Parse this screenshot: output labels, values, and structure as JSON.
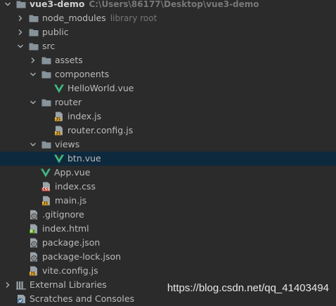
{
  "project": {
    "name": "vue3-demo",
    "path": "C:\\Users\\86177\\Desktop\\vue3-demo"
  },
  "items": [
    {
      "depth": 0,
      "arrow": "expanded",
      "icon": "folder",
      "label": "vue3-demo",
      "hint": "C:\\Users\\86177\\Desktop\\vue3-demo",
      "bold": true,
      "root": true
    },
    {
      "depth": 1,
      "arrow": "collapsed",
      "icon": "folder",
      "label": "node_modules",
      "hint": "library root"
    },
    {
      "depth": 1,
      "arrow": "collapsed",
      "icon": "folder",
      "label": "public",
      "hint": ""
    },
    {
      "depth": 1,
      "arrow": "expanded",
      "icon": "folder",
      "label": "src",
      "hint": ""
    },
    {
      "depth": 2,
      "arrow": "collapsed",
      "icon": "folder",
      "label": "assets",
      "hint": ""
    },
    {
      "depth": 2,
      "arrow": "expanded",
      "icon": "folder",
      "label": "components",
      "hint": ""
    },
    {
      "depth": 3,
      "arrow": "none",
      "icon": "vue",
      "label": "HelloWorld.vue",
      "hint": ""
    },
    {
      "depth": 2,
      "arrow": "expanded",
      "icon": "folder",
      "label": "router",
      "hint": ""
    },
    {
      "depth": 3,
      "arrow": "none",
      "icon": "js",
      "label": "index.js",
      "hint": ""
    },
    {
      "depth": 3,
      "arrow": "none",
      "icon": "js",
      "label": "router.config.js",
      "hint": ""
    },
    {
      "depth": 2,
      "arrow": "expanded",
      "icon": "folder",
      "label": "views",
      "hint": ""
    },
    {
      "depth": 3,
      "arrow": "none",
      "icon": "vue",
      "label": "btn.vue",
      "hint": "",
      "selected": true
    },
    {
      "depth": 2,
      "arrow": "none",
      "icon": "vue",
      "label": "App.vue",
      "hint": "",
      "shift": -1
    },
    {
      "depth": 2,
      "arrow": "none",
      "icon": "css",
      "label": "index.css",
      "hint": ""
    },
    {
      "depth": 2,
      "arrow": "none",
      "icon": "js",
      "label": "main.js",
      "hint": ""
    },
    {
      "depth": 1,
      "arrow": "none",
      "icon": "gitignore",
      "label": ".gitignore",
      "hint": ""
    },
    {
      "depth": 1,
      "arrow": "none",
      "icon": "html",
      "label": "index.html",
      "hint": ""
    },
    {
      "depth": 1,
      "arrow": "none",
      "icon": "json",
      "label": "package.json",
      "hint": ""
    },
    {
      "depth": 1,
      "arrow": "none",
      "icon": "json",
      "label": "package-lock.json",
      "hint": ""
    },
    {
      "depth": 1,
      "arrow": "none",
      "icon": "js",
      "label": "vite.config.js",
      "hint": ""
    },
    {
      "depth": 0,
      "arrow": "collapsed",
      "icon": "libraries",
      "label": "External Libraries",
      "hint": ""
    },
    {
      "depth": 0,
      "arrow": "none",
      "icon": "scratches",
      "label": "Scratches and Consoles",
      "hint": ""
    }
  ],
  "watermark": "https://blog.csdn.net/qq_41403494",
  "colors": {
    "background": "#2b2b2b",
    "selection": "#0d293e",
    "folder": "#87939a",
    "vue": "#41b883",
    "js_badge": "#f0b132",
    "css_badge": "#c0392b",
    "html_badge": "#4e9a06",
    "text": "#bbbbbb",
    "hint": "#787878"
  }
}
